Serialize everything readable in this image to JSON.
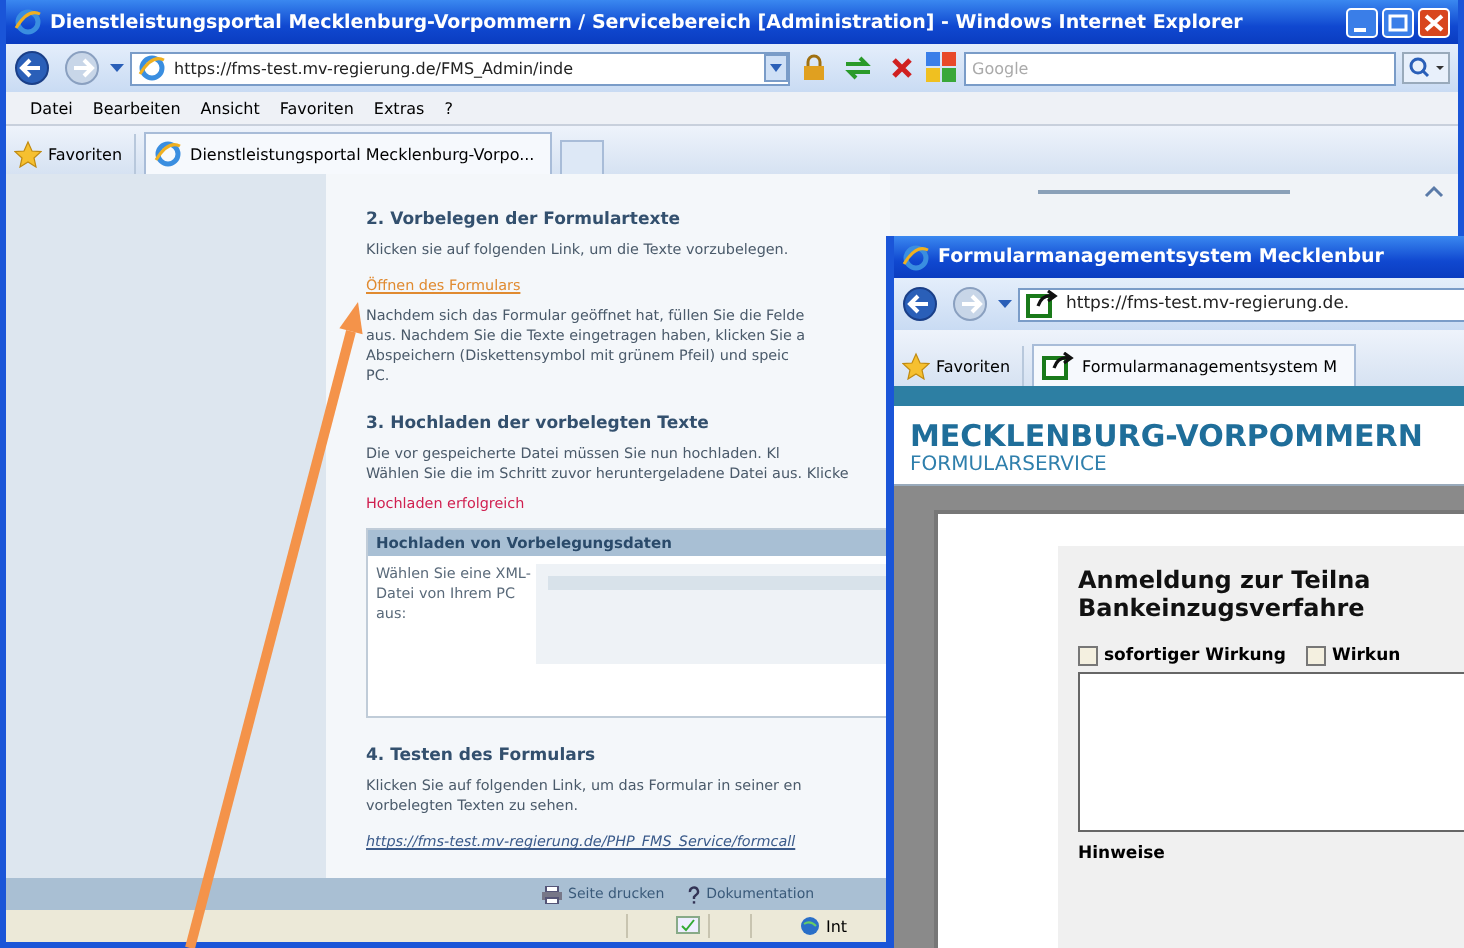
{
  "window": {
    "title": "Dienstleistungsportal Mecklenburg-Vorpommern / Servicebereich [Administration] - Windows Internet Explorer"
  },
  "address_bar": {
    "url": "https://fms-test.mv-regierung.de/FMS_Admin/inde"
  },
  "search": {
    "placeholder": "Google"
  },
  "menu": [
    "Datei",
    "Bearbeiten",
    "Ansicht",
    "Favoriten",
    "Extras",
    "?"
  ],
  "favorites": "Favoriten",
  "tabs": [
    {
      "label": "Dienstleistungsportal Mecklenburg-Vorpo...",
      "selected": true
    }
  ],
  "content": {
    "step2": {
      "heading": "2. Vorbelegen der Formulartexte",
      "intro": "Klicken sie auf folgenden Link, um die Texte vorzubelegen.",
      "link": "Öffnen des Formulars",
      "text": "Nachdem sich das Formular geöffnet hat, füllen Sie die Felde\naus. Nachdem Sie die Texte eingetragen haben, klicken Sie a\nAbspeichern (Diskettensymbol mit grünem Pfeil) und speic\nPC."
    },
    "step3": {
      "heading": "3. Hochladen der vorbelegten Texte",
      "text": "Die vor gespeicherte Datei müssen Sie nun hochladen. Kl\nWählen Sie die im Schritt zuvor heruntergeladene Datei aus. Klicke",
      "message": "Hochladen erfolgreich"
    },
    "upload_panel": {
      "title": "Hochladen von Vorbelegungsdaten",
      "label": "Wählen Sie eine XML-Datei von Ihrem PC aus:"
    },
    "step4": {
      "heading": "4. Testen des Formulars",
      "text": "Klicken Sie auf folgenden Link, um das Formular in seiner en\nvorbelegten Texten zu sehen.",
      "link": "https://fms-test.mv-regierung.de/PHP_FMS_Service/formcall"
    }
  },
  "footer_links": [
    {
      "kind": "print",
      "label": "Seite drucken"
    },
    {
      "kind": "help",
      "label": "Dokumentation"
    }
  ],
  "status_bar": {
    "zone": "Int"
  },
  "popup_window": {
    "title": "Formularmanagementsystem Mecklenbur",
    "url": "https://fms-test.mv-regierung.de.",
    "favorites": "Favoriten",
    "tabs": [
      {
        "label": "Formularmanagementsystem M",
        "selected": true
      }
    ],
    "brand": "MECKLENBURG-VORPOMMERN",
    "subtitle": "FORMULARSERVICE",
    "form_title": "Anmeldung zur Teilna\nBankeinzugsverfahre",
    "options": [
      {
        "label": "sofortiger Wirkung",
        "checked": false
      },
      {
        "label": "Wirkun",
        "checked": false
      }
    ],
    "next_heading": "Hinweise"
  }
}
